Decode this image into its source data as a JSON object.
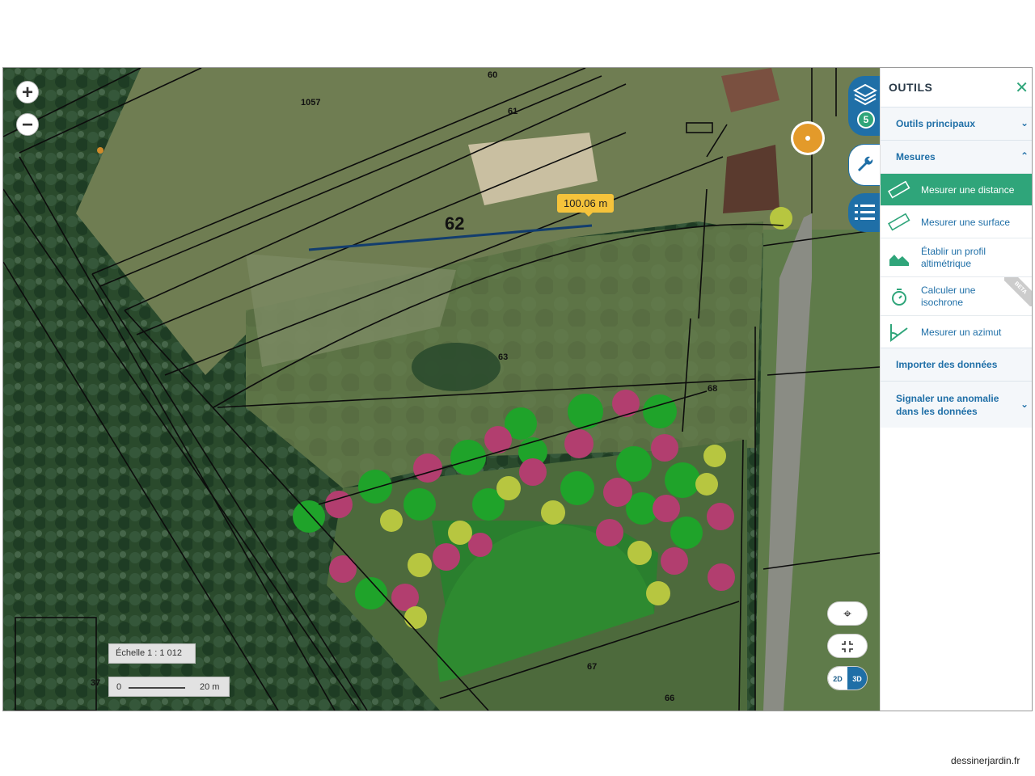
{
  "map": {
    "parcels": [
      "60",
      "1057",
      "61",
      "62",
      "63",
      "68",
      "67",
      "66",
      "37"
    ],
    "measurement": "100.06 m",
    "scale_label": "Échelle 1 : 1 012",
    "scale_bar_zero": "0",
    "scale_bar_length": "20 m",
    "zoom_in": "+",
    "zoom_out": "−",
    "mode_2d": "2D",
    "mode_3d": "3D",
    "layer_count": "5"
  },
  "panel": {
    "title": "OUTILS",
    "close": "✕",
    "sections": {
      "main": "Outils principaux",
      "measures": "Mesures",
      "import": "Importer des données",
      "report": "Signaler une anomalie dans les données"
    },
    "tools": {
      "distance": "Mesurer une distance",
      "surface": "Mesurer une surface",
      "profile": "Établir un profil altimétrique",
      "isochrone": "Calculer une isochrone",
      "azimuth": "Mesurer un azimut"
    },
    "beta": "BETA"
  },
  "credit": "dessinerjardin.fr",
  "colors": {
    "brand_blue": "#1f6fa7",
    "active_green": "#2fa57a",
    "tooltip_yellow": "#f5c33b",
    "marker_orange": "#e39a2a"
  }
}
